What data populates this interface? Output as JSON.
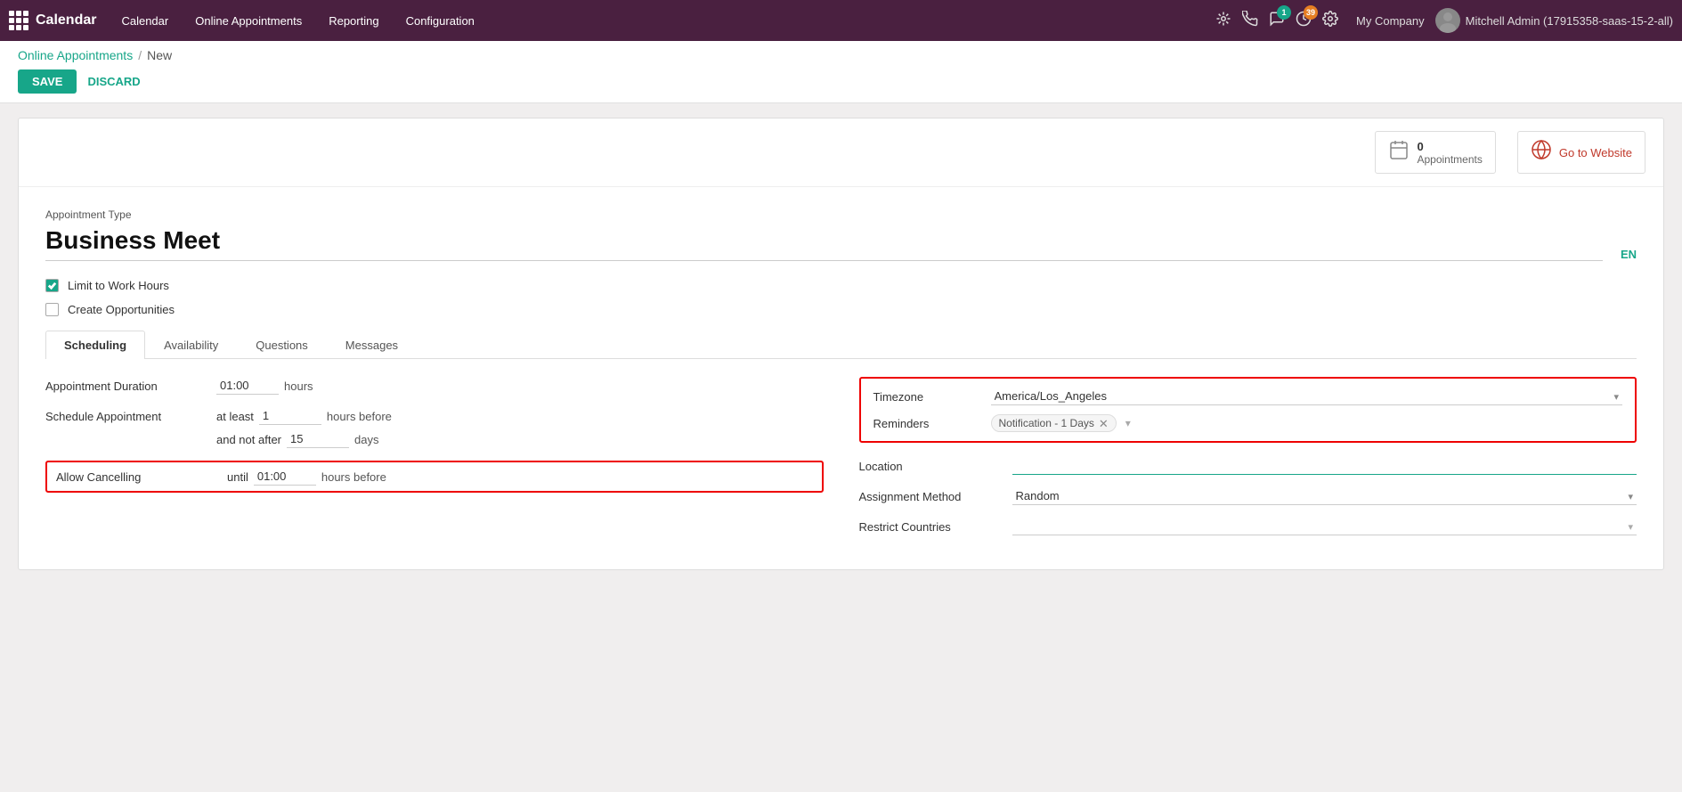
{
  "app": {
    "logo_text": "Calendar",
    "nav_items": [
      "Calendar",
      "Online Appointments",
      "Reporting",
      "Configuration"
    ]
  },
  "topbar": {
    "company": "My Company",
    "user": "Mitchell Admin (17915358-saas-15-2-all)",
    "badge_chat": "1",
    "badge_activity": "39"
  },
  "breadcrumb": {
    "parent": "Online Appointments",
    "current": "New"
  },
  "actions": {
    "save": "SAVE",
    "discard": "DISCARD"
  },
  "stats": {
    "appointments_count": "0",
    "appointments_label": "Appointments",
    "goto_label": "Go to Website"
  },
  "form": {
    "appointment_type_label": "Appointment Type",
    "title": "Business Meet",
    "lang": "EN",
    "limit_work_hours_label": "Limit to Work Hours",
    "limit_work_hours_checked": true,
    "create_opportunities_label": "Create Opportunities",
    "create_opportunities_checked": false
  },
  "tabs": {
    "items": [
      "Scheduling",
      "Availability",
      "Questions",
      "Messages"
    ],
    "active": "Scheduling"
  },
  "scheduling": {
    "duration_label": "Appointment Duration",
    "duration_value": "01:00",
    "duration_suffix": "hours",
    "schedule_label": "Schedule Appointment",
    "schedule_prefix": "at least",
    "schedule_min": "1",
    "schedule_suffix": "hours before",
    "schedule_notafter": "and not after",
    "schedule_max": "15",
    "schedule_days": "days",
    "allow_cancel_label": "Allow Cancelling",
    "allow_cancel_prefix": "until",
    "allow_cancel_value": "01:00",
    "allow_cancel_suffix": "hours before"
  },
  "right_panel": {
    "timezone_label": "Timezone",
    "timezone_value": "America/Los_Angeles",
    "reminders_label": "Reminders",
    "reminder_chip": "Notification - 1 Days",
    "location_label": "Location",
    "location_value": "",
    "assignment_label": "Assignment Method",
    "assignment_value": "Random",
    "restrict_label": "Restrict Countries",
    "restrict_value": ""
  }
}
